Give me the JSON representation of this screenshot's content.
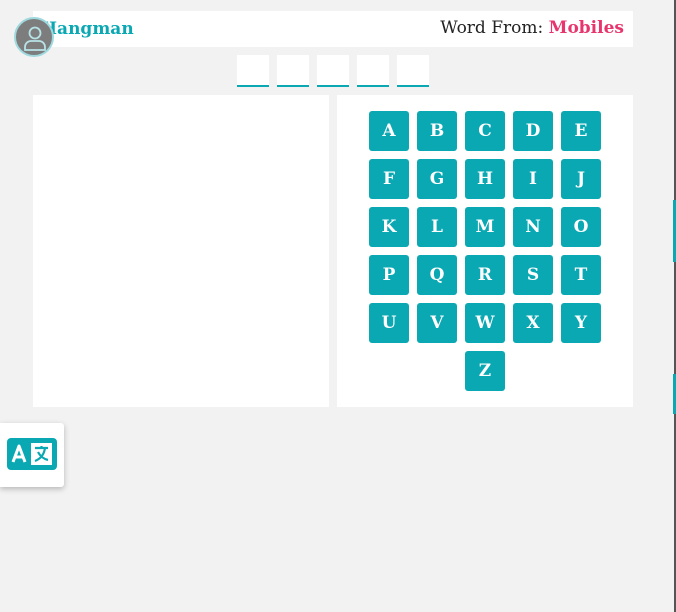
{
  "header": {
    "title": "Hangman",
    "word_from_label": "Word From:",
    "category": "Mobiles"
  },
  "word": {
    "length": 5
  },
  "keyboard": {
    "letters": [
      "A",
      "B",
      "C",
      "D",
      "E",
      "F",
      "G",
      "H",
      "I",
      "J",
      "K",
      "L",
      "M",
      "N",
      "O",
      "P",
      "Q",
      "R",
      "S",
      "T",
      "U",
      "V",
      "W",
      "X",
      "Y",
      "Z"
    ]
  },
  "colors": {
    "accent": "#0aa8b3",
    "category": "#e8356d"
  },
  "icons": {
    "avatar": "user-icon",
    "translate": "translate-icon"
  }
}
